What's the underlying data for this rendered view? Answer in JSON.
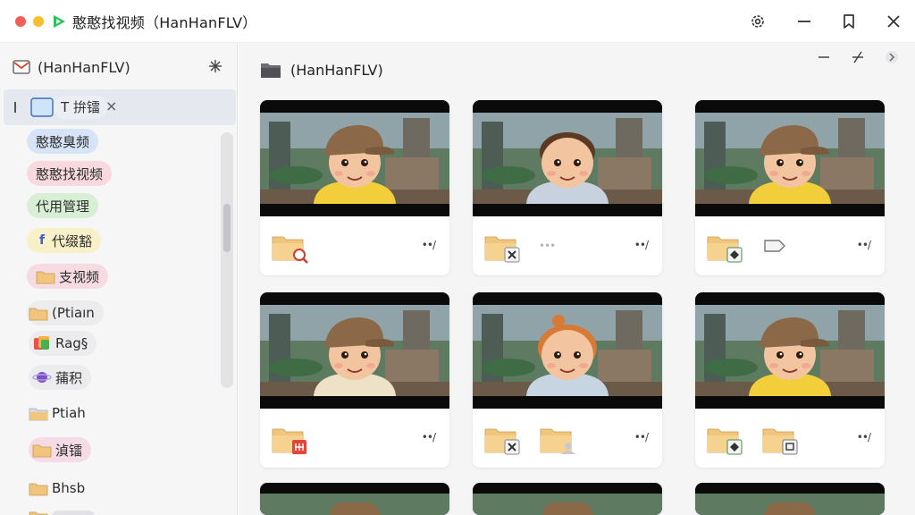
{
  "window": {
    "title": "憨憨找视频（HanHanFLV）"
  },
  "sidebar": {
    "header_label": "(HanHanFLV)",
    "active_item": {
      "label": "T 拚镭"
    },
    "items": [
      {
        "label": "憨憨臭频",
        "color": "#d7e3f7"
      },
      {
        "label": "憨憨找视频",
        "color": "#f7d9df"
      },
      {
        "label": "代用管理",
        "color": "#d8efd6"
      },
      {
        "label": "代缀豁",
        "color": "#f8f0c8"
      },
      {
        "label": "支视频",
        "color": "#f7dbe3"
      },
      {
        "label": "(Ptiaın",
        "color": "#ececee"
      },
      {
        "label": "Rag§",
        "color": "#ececee"
      },
      {
        "label": "蒱积",
        "color": "#ececee"
      },
      {
        "label": "Ptiah",
        "color": ""
      },
      {
        "label": "湞镭",
        "color": "#f5dbe5"
      },
      {
        "label": "Bhsb",
        "color": ""
      }
    ]
  },
  "main": {
    "header_label": "(HanHanFLV)",
    "more_label": "••/",
    "cards": [
      {
        "name": "card-1",
        "variant": "cap-yellow",
        "icons": [
          "folder-search"
        ]
      },
      {
        "name": "card-2",
        "variant": "boy-blue",
        "icons": [
          "folder-x"
        ],
        "dots": "•••"
      },
      {
        "name": "card-3",
        "variant": "cap-yellow",
        "icons": [
          "folder-diamond",
          "tag"
        ]
      },
      {
        "name": "card-4",
        "variant": "cap-cream",
        "icons": [
          "folder-grid"
        ]
      },
      {
        "name": "card-5",
        "variant": "ginger",
        "icons": [
          "folder-x",
          "folder-user"
        ]
      },
      {
        "name": "card-6",
        "variant": "cap-yellow",
        "icons": [
          "folder-diamond",
          "folder-image"
        ]
      }
    ]
  },
  "colors": {
    "accent_green": "#27c45a",
    "folder": "#f1c67c"
  }
}
